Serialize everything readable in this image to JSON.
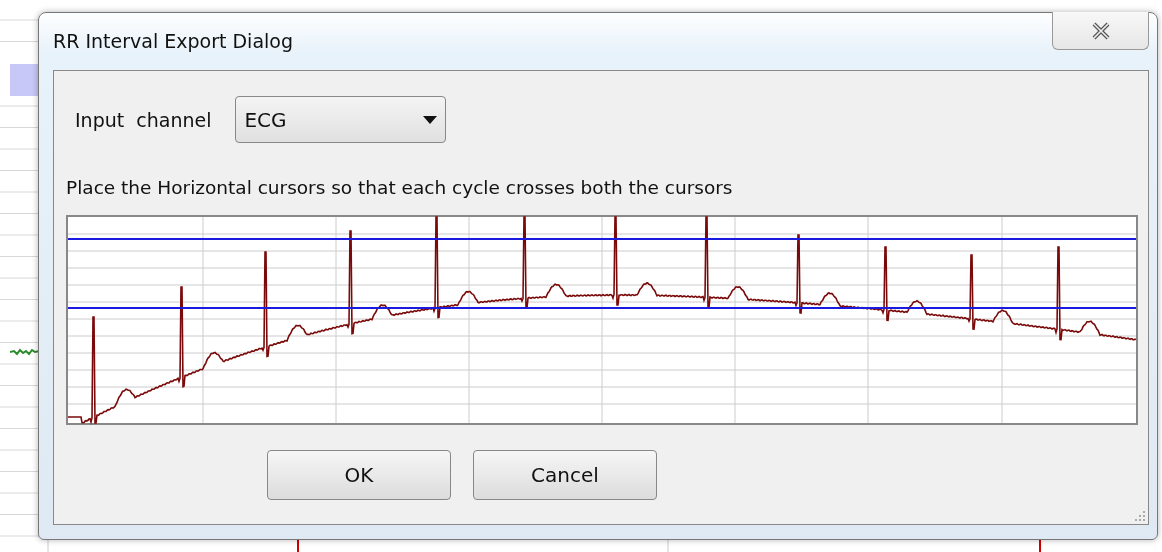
{
  "dialog": {
    "title": "RR Interval Export Dialog",
    "input_channel": {
      "label": "Input  channel",
      "value": "ECG"
    },
    "instruction": "Place the Horizontal cursors so that each cycle crosses both the cursors",
    "buttons": [
      {
        "label": "OK"
      },
      {
        "label": "Cancel"
      }
    ]
  }
}
